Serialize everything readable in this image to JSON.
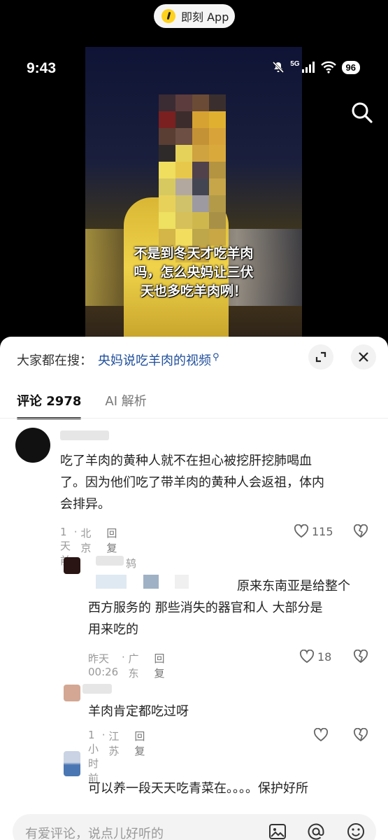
{
  "app_pill": {
    "label": "即刻 App"
  },
  "status_bar": {
    "time": "9:43",
    "network": "5G",
    "battery": "96"
  },
  "video": {
    "caption_lines": [
      "不是到冬天才吃羊肉",
      "吗，怎么央妈让三伏",
      "天也多吃羊肉咧！"
    ]
  },
  "sheet": {
    "search_prefix": "大家都在搜：",
    "search_link": "央妈说吃羊肉的视频",
    "tabs": [
      {
        "label": "评论 2978"
      },
      {
        "label": "AI 解析"
      }
    ],
    "comments": [
      {
        "lines": [
          "吃了羊肉的黄种人就不在担心被挖肝挖肺喝血",
          "了。因为他们吃了带羊肉的黄种人会返祖，体内",
          "会排异。"
        ],
        "time": "1天前",
        "location": "北京",
        "reply_label": "回复",
        "likes": "115"
      },
      {
        "name_fragment": "鸫",
        "lines": [
          "原来东南亚是给整个",
          "西方服务的 那些消失的器官和人 大部分是",
          "用来吃的"
        ],
        "time": "昨天00:26",
        "location": "广东",
        "reply_label": "回复",
        "likes": "18"
      },
      {
        "lines": [
          "羊肉肯定都吃过呀"
        ],
        "time": "1小时前",
        "location": "江苏",
        "reply_label": "回复"
      },
      {
        "lines": [
          "可以养一段天天吃青菜在。。。。保护好所"
        ]
      }
    ],
    "input_placeholder": "有爱评论，说点儿好听的"
  }
}
